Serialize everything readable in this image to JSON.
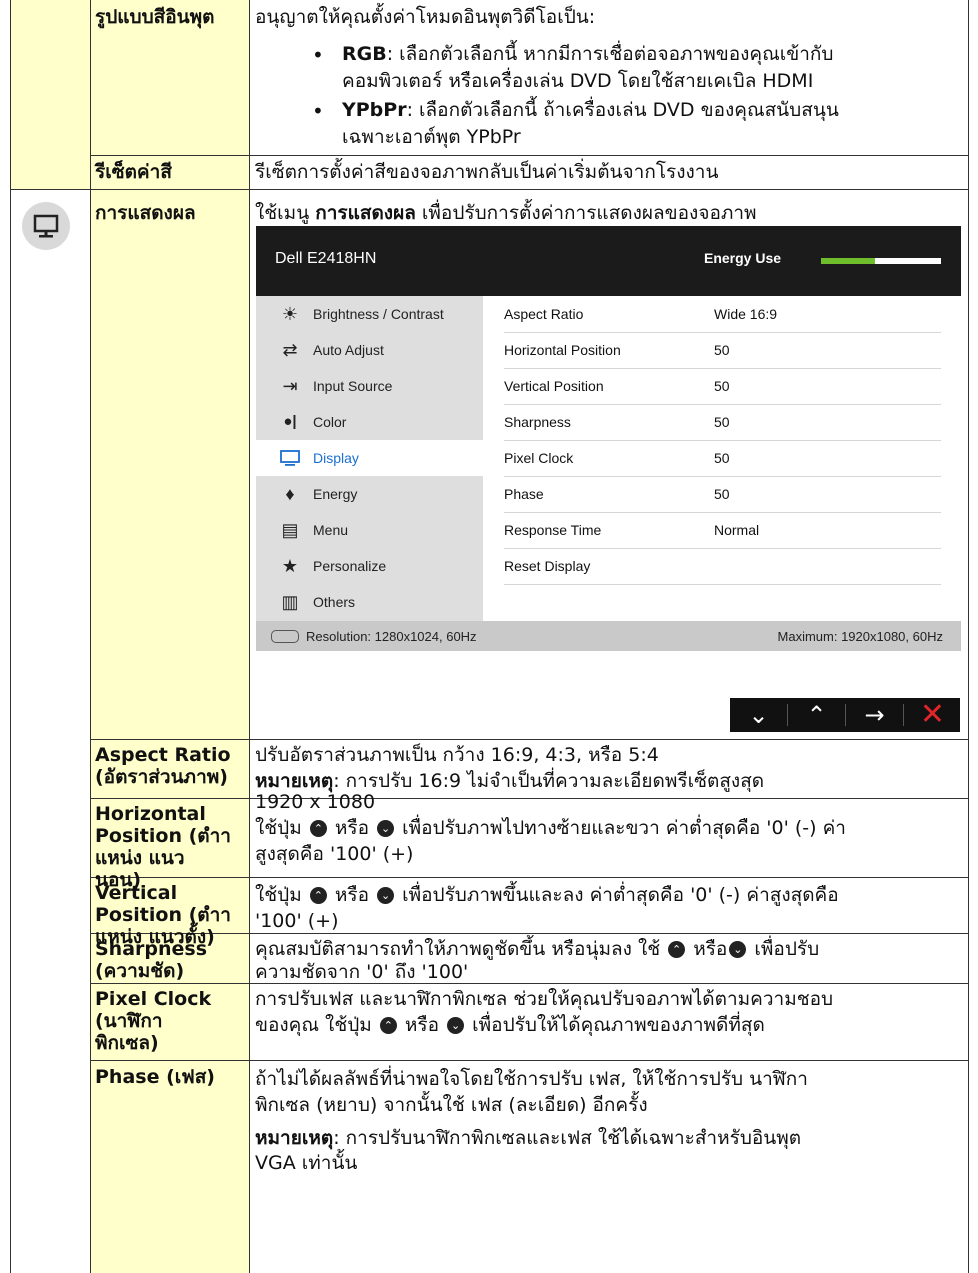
{
  "table_rows": {
    "input_color_format": {
      "label": "รูปแบบสีอินพุต",
      "intro": "อนุญาตให้คุณตั้งค่าโหมดอินพุตวิดีโอเป็น:",
      "rgb_term": "RGB",
      "rgb_text_1": ": เลือกตัวเลือกนี้ หากมีการเชื่อต่อจอภาพของคุณเข้ากับ",
      "rgb_text_2": "คอมพิวเตอร์ หรือเครื่องเล่น DVD โดยใช้สายเคเบิล HDMI",
      "ypbpr_term": "YPbPr",
      "ypbpr_text_1": ": เลือกตัวเลือกนี้ ถ้าเครื่องเล่น DVD ของคุณสนับสนุน",
      "ypbpr_text_2": "เฉพาะเอาต์พุต YPbPr"
    },
    "reset_color": {
      "label": "รีเซ็ตค่าสี",
      "text": "รีเซ็ตการตั้งค่าสีของจอภาพกลับเป็นค่าเริ่มต้นจากโรงงาน"
    },
    "display": {
      "label": "การแสดงผล",
      "text_pre": "ใช้เมนู ",
      "text_bold": "การแสดงผล",
      "text_post": " เพื่อปรับการตั้งค่าการแสดงผลของจอภาพ"
    },
    "aspect_ratio": {
      "label": "Aspect Ratio (อัตราส่วนภาพ)",
      "text": "ปรับอัตราส่วนภาพเป็น กว้าง 16:9, 4:3, หรือ 5:4",
      "note_term": "หมายเหตุ",
      "note_text_1": ": การปรับ 16:9 ไม่จำเป็นที่ความละเอียดพรีเซ็ตสูงสุด",
      "note_text_2": "1920 x 1080"
    },
    "horizontal_position": {
      "label_1": "Horizontal",
      "label_2": "Position (ตำา",
      "label_3": "แหน่ง แนว",
      "label_4": "นอน)",
      "text_1a": "ใช้ปุ่ม ",
      "text_1b": " หรือ ",
      "text_1c": " เพื่อปรับภาพไปทางซ้ายและขวา ค่าต่ำสุดคือ '0' (-) ค่า",
      "text_2": "สูงสุดคือ '100' (+)"
    },
    "vertical_position": {
      "label_1": "Vertical",
      "label_2": "Position (ตำา",
      "label_3": "แหน่ง แนวตั้ง)",
      "text_1a": " ใช้ปุ่ม ",
      "text_1b": " หรือ ",
      "text_1c": " เพื่อปรับภาพขึ้นและลง ค่าต่ำสุดคือ '0' (-) ค่าสูงสุดคือ",
      "text_2": "'100' (+)"
    },
    "sharpness": {
      "label_1": "Sharpness",
      "label_2": "(ความชัด)",
      "text_1a": "คุณสมบัติสามารถทำให้ภาพดูชัดขึ้น หรือนุ่มลง ใช้ ",
      "text_1b": " หรือ",
      "text_1c": " เพื่อปรับ",
      "text_2": "ความชัดจาก '0' ถึง '100'"
    },
    "pixel_clock": {
      "label_1": "Pixel Clock",
      "label_2": "(นาฬิกา",
      "label_3": "พิกเซล)",
      "text_1": "การปรับเฟส และนาฬิกาพิกเซล ช่วยให้คุณปรับจอภาพได้ตามความชอบ",
      "text_2a": "ของคุณ ใช้ปุ่ม ",
      "text_2b": " หรือ ",
      "text_2c": " เพื่อปรับให้ได้คุณภาพของภาพดีที่สุด"
    },
    "phase": {
      "label": "Phase (เฟส)",
      "text_1": "ถ้าไม่ได้ผลลัพธ์ที่น่าพอใจโดยใช้การปรับ เฟส, ให้ใช้การปรับ นาฬิกา",
      "text_2": "พิกเซล (หยาบ) จากนั้นใช้ เฟส (ละเอียด) อีกครั้ง",
      "note_term": "หมายเหตุ",
      "note_text_1": ": การปรับนาฬิกาพิกเซลและเฟส ใช้ได้เฉพาะสำหรับอินพุต",
      "note_text_2": "VGA เท่านั้น"
    }
  },
  "osd": {
    "model": "Dell E2418HN",
    "energy_label": "Energy Use",
    "energy_level": 0.45,
    "menu_items": [
      {
        "label": "Brightness / Contrast",
        "icon": "brightness-icon"
      },
      {
        "label": "Auto Adjust",
        "icon": "auto-adjust-icon"
      },
      {
        "label": "Input Source",
        "icon": "input-source-icon"
      },
      {
        "label": "Color",
        "icon": "color-icon"
      },
      {
        "label": "Display",
        "icon": "display-icon",
        "selected": true
      },
      {
        "label": "Energy",
        "icon": "energy-icon"
      },
      {
        "label": "Menu",
        "icon": "menu-icon"
      },
      {
        "label": "Personalize",
        "icon": "star-icon"
      },
      {
        "label": "Others",
        "icon": "others-icon"
      }
    ],
    "settings": [
      {
        "name": "Aspect Ratio",
        "value": "Wide 16:9"
      },
      {
        "name": "Horizontal Position",
        "value": "50"
      },
      {
        "name": "Vertical Position",
        "value": "50"
      },
      {
        "name": "Sharpness",
        "value": "50"
      },
      {
        "name": "Pixel Clock",
        "value": "50"
      },
      {
        "name": "Phase",
        "value": "50"
      },
      {
        "name": "Response Time",
        "value": "Normal"
      },
      {
        "name": "Reset Display",
        "value": ""
      }
    ],
    "resolution": "Resolution: 1280x1024, 60Hz",
    "maximum": "Maximum: 1920x1080, 60Hz",
    "accent_color": "#1b6fd0",
    "energy_color": "#6fbf2d",
    "close_color": "#e0262a"
  }
}
